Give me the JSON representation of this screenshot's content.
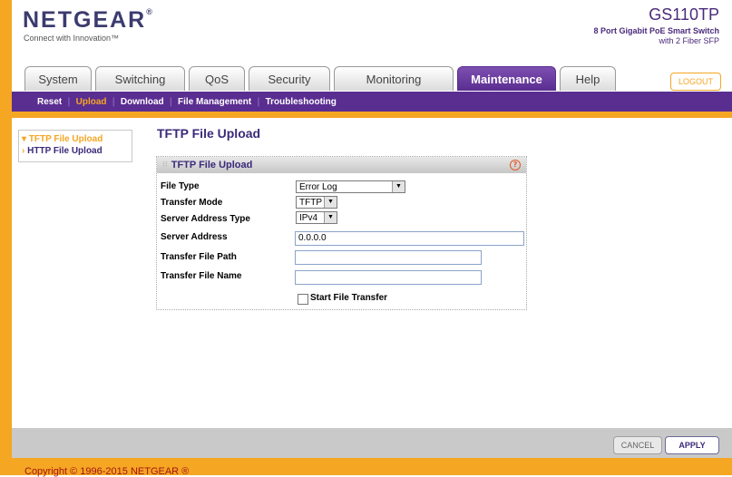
{
  "header": {
    "brand": "NETGEAR",
    "registered": "®",
    "tagline": "Connect with Innovation™",
    "model": "GS110TP",
    "model_line1": "8 Port Gigabit PoE Smart Switch",
    "model_line2": "with 2 Fiber SFP"
  },
  "tabs": [
    {
      "label": "System"
    },
    {
      "label": "Switching"
    },
    {
      "label": "QoS"
    },
    {
      "label": "Security"
    },
    {
      "label": "Monitoring"
    },
    {
      "label": "Maintenance",
      "active": true
    },
    {
      "label": "Help"
    }
  ],
  "logout_label": "LOGOUT",
  "subnav": [
    {
      "label": "Reset"
    },
    {
      "label": "Upload",
      "active": true
    },
    {
      "label": "Download"
    },
    {
      "label": "File Management"
    },
    {
      "label": "Troubleshooting"
    }
  ],
  "leftnav": {
    "items": [
      {
        "label": "TFTP File Upload",
        "active": true,
        "prefix": "▾"
      },
      {
        "label": "HTTP File Upload",
        "active": false,
        "prefix": "›"
      }
    ]
  },
  "main": {
    "page_title": "TFTP File Upload",
    "panel_title": "TFTP File Upload",
    "help_glyph": "?",
    "fields": {
      "file_type": {
        "label": "File Type",
        "value": "Error Log"
      },
      "transfer_mode": {
        "label": "Transfer Mode",
        "value": "TFTP"
      },
      "server_address_type": {
        "label": "Server Address Type",
        "value": "IPv4"
      },
      "server_address": {
        "label": "Server Address",
        "value": "0.0.0.0"
      },
      "transfer_file_path": {
        "label": "Transfer File Path",
        "value": ""
      },
      "transfer_file_name": {
        "label": "Transfer File Name",
        "value": ""
      }
    },
    "start_transfer_label": "Start File Transfer",
    "start_transfer_checked": false
  },
  "footer": {
    "cancel_label": "CANCEL",
    "apply_label": "APPLY",
    "copyright": "Copyright © 1996-2015 NETGEAR ®"
  },
  "colors": {
    "accent_orange": "#f5a623",
    "brand_purple": "#5a2d91"
  }
}
